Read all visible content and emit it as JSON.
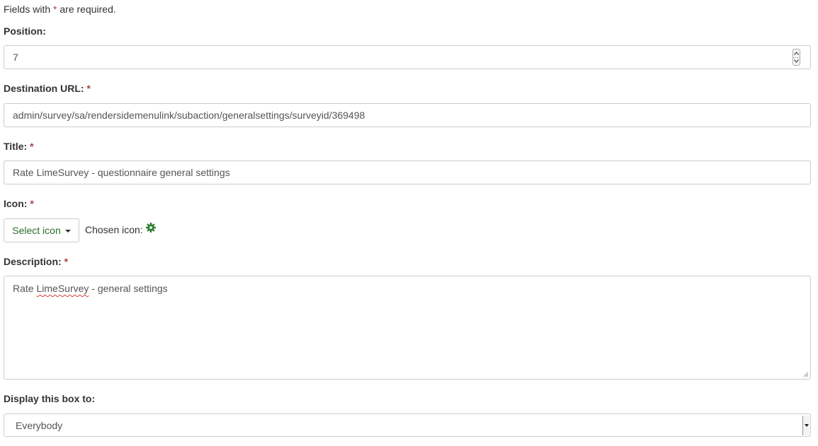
{
  "form": {
    "required_note_prefix": "Fields with ",
    "required_marker": "*",
    "required_note_suffix": " are required.",
    "position": {
      "label": "Position:",
      "value": "7"
    },
    "destination_url": {
      "label": "Destination URL:",
      "value": "admin/survey/sa/rendersidemenulink/subaction/generalsettings/surveyid/369498"
    },
    "title": {
      "label": "Title:",
      "value": "Rate LimeSurvey - questionnaire general settings"
    },
    "icon": {
      "label": "Icon:",
      "select_button_label": "Select icon",
      "chosen_label": "Chosen icon:",
      "chosen_icon_name": "gear-icon",
      "chosen_icon_color": "#2e7d32"
    },
    "description": {
      "label": "Description:",
      "value_prefix": "Rate ",
      "value_misspelled": "LimeSurvey",
      "value_suffix": " - general settings"
    },
    "display_box": {
      "label": "Display this box to:",
      "selected": "Everybody"
    }
  },
  "colors": {
    "required": "#a94442",
    "border": "#cccccc",
    "button_text": "#2b6b2b",
    "spellcheck": "#d43f3a"
  }
}
